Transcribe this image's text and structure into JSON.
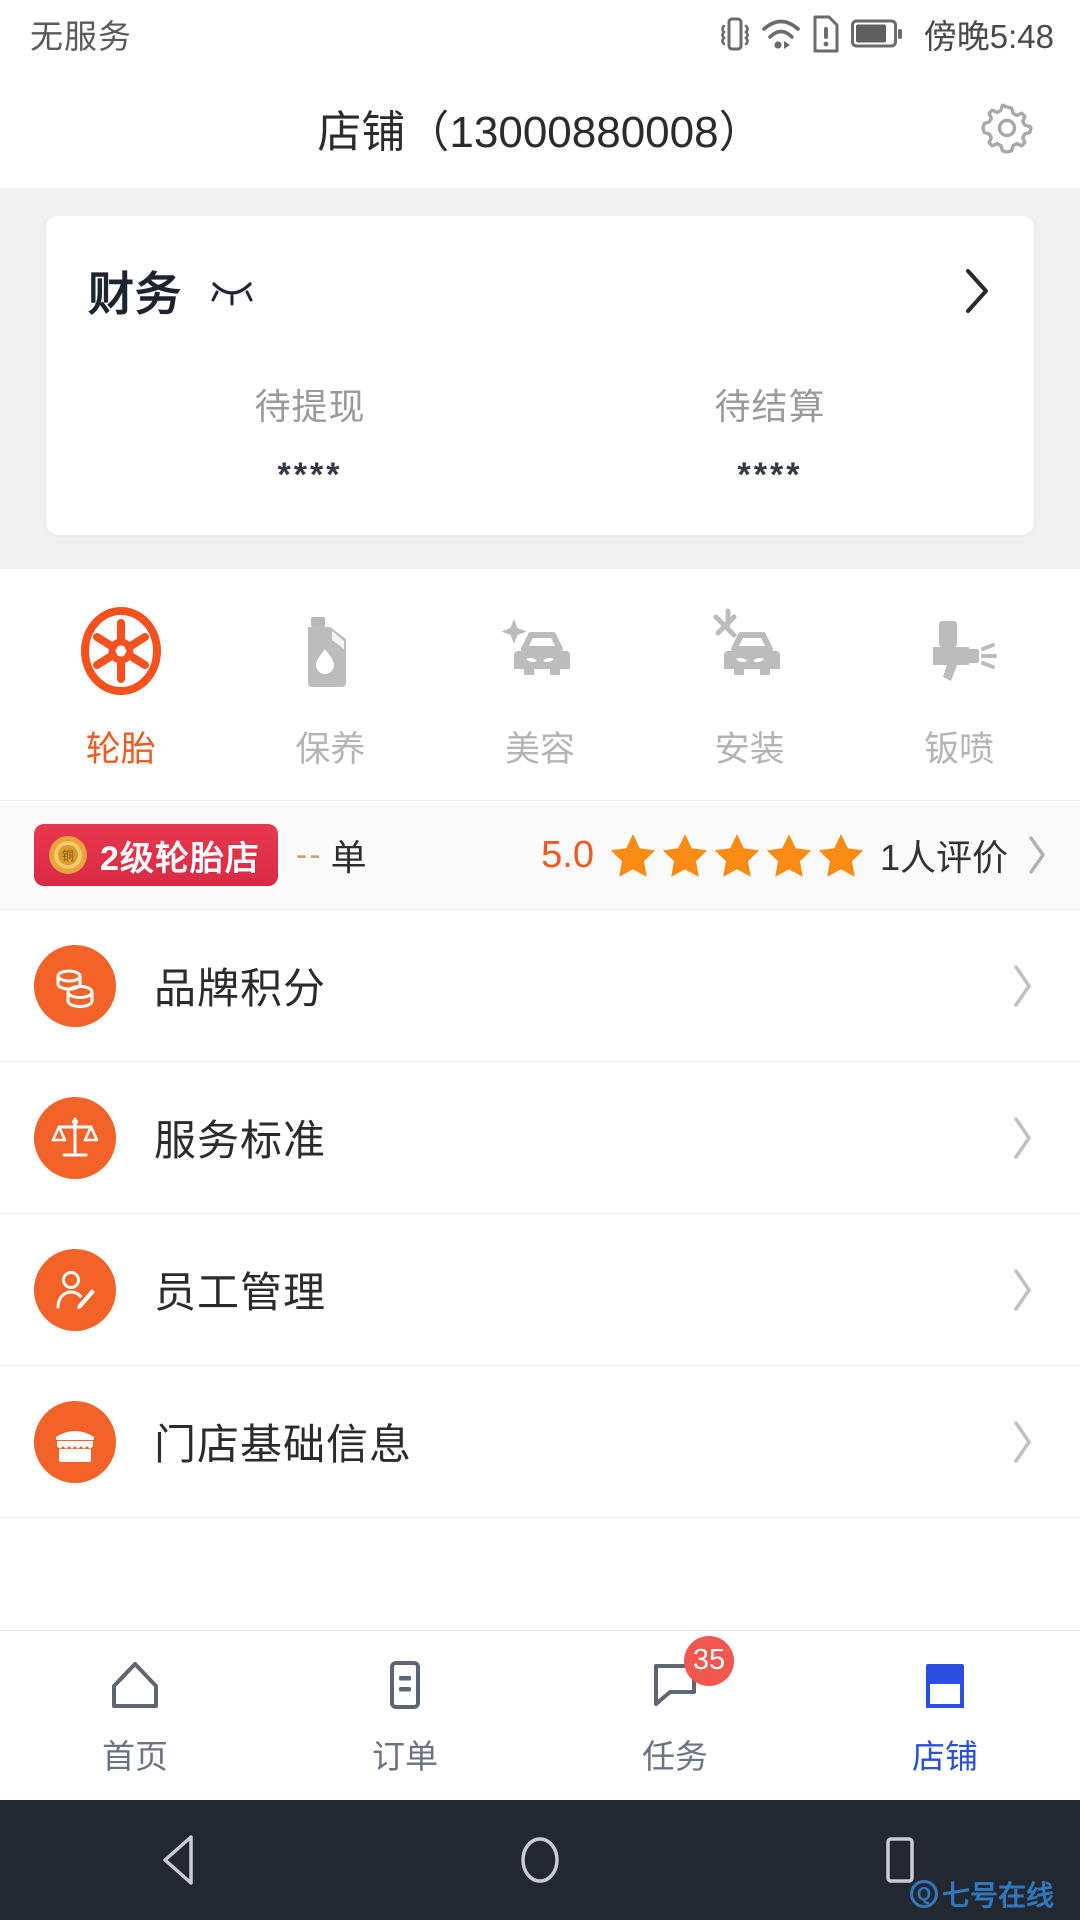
{
  "status_bar": {
    "carrier": "无服务",
    "time": "傍晚5:48",
    "icons": [
      "vibrate-icon",
      "wifi-icon",
      "sim-alert-icon",
      "battery-icon"
    ]
  },
  "header": {
    "title": "店铺（13000880008）",
    "settings_icon": "gear-icon"
  },
  "finance": {
    "title": "财务",
    "eye_icon": "eye-closed-icon",
    "arrow_icon": "chevron-right-icon",
    "stats": [
      {
        "label": "待提现",
        "value": "****"
      },
      {
        "label": "待结算",
        "value": "****"
      }
    ]
  },
  "services": [
    {
      "label": "轮胎",
      "icon": "tire-wheel-icon",
      "active": true
    },
    {
      "label": "保养",
      "icon": "oil-can-icon",
      "active": false
    },
    {
      "label": "美容",
      "icon": "car-sparkle-icon",
      "active": false
    },
    {
      "label": "安装",
      "icon": "car-wrench-icon",
      "active": false
    },
    {
      "label": "钣喷",
      "icon": "spray-gun-icon",
      "active": false
    }
  ],
  "shop_summary": {
    "level_badge": "2级轮胎店",
    "medal_icon": "bronze-medal-icon",
    "medal_char": "铜",
    "order_count": "--",
    "order_unit": "单",
    "rating": "5.0",
    "stars_filled": 5,
    "review_count": "1人评价",
    "arrow_icon": "chevron-right-icon"
  },
  "menu": [
    {
      "label": "品牌积分",
      "icon": "coins-icon"
    },
    {
      "label": "服务标准",
      "icon": "scales-icon"
    },
    {
      "label": "员工管理",
      "icon": "staff-icon"
    },
    {
      "label": "门店基础信息",
      "icon": "storefront-icon"
    }
  ],
  "tabbar": [
    {
      "label": "首页",
      "icon": "home-icon",
      "badge": "",
      "active": false
    },
    {
      "label": "订单",
      "icon": "order-list-icon",
      "badge": "",
      "active": false
    },
    {
      "label": "任务",
      "icon": "task-chat-icon",
      "badge": "35",
      "active": false
    },
    {
      "label": "店铺",
      "icon": "shop-icon",
      "badge": "",
      "active": true
    }
  ],
  "android_nav": {
    "back_icon": "back-triangle-icon",
    "home_icon": "home-circle-icon",
    "recents_icon": "recents-square-icon"
  },
  "watermark": {
    "text": "七号在线"
  },
  "colors": {
    "accent_orange": "#f05a23",
    "badge_red": "#e8384f",
    "active_blue": "#2a4ee0",
    "star_orange": "#fa8c16",
    "badge_dot_red": "#f0574f"
  }
}
